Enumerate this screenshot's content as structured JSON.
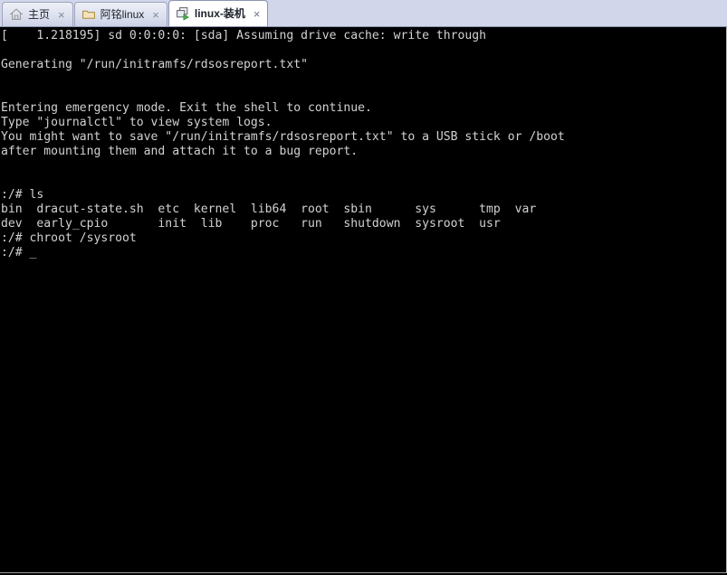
{
  "window": {
    "tabbar_bg": "#d2d6ea",
    "terminal_bg": "#000000",
    "terminal_fg": "#d2d2d2"
  },
  "tabs": [
    {
      "label": "主页",
      "icon": "home-icon",
      "close_label": "×",
      "active": false
    },
    {
      "label": "阿铭linux",
      "icon": "folder-icon",
      "close_label": "×",
      "active": false
    },
    {
      "label": "linux-装机",
      "icon": "remote-session-icon",
      "close_label": "×",
      "active": true
    }
  ],
  "terminal": {
    "lines": [
      "[    1.218195] sd 0:0:0:0: [sda] Assuming drive cache: write through",
      "",
      "Generating \"/run/initramfs/rdsosreport.txt\"",
      "",
      "",
      "Entering emergency mode. Exit the shell to continue.",
      "Type \"journalctl\" to view system logs.",
      "You might want to save \"/run/initramfs/rdsosreport.txt\" to a USB stick or /boot",
      "after mounting them and attach it to a bug report.",
      "",
      "",
      ":/# ls",
      "bin  dracut-state.sh  etc  kernel  lib64  root  sbin      sys      tmp  var",
      "dev  early_cpio       init  lib    proc   run   shutdown  sysroot  usr",
      ":/# chroot /sysroot",
      ":/# _"
    ]
  }
}
